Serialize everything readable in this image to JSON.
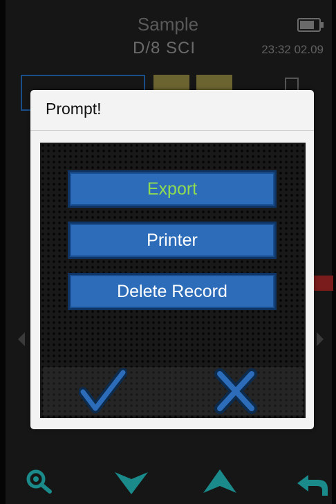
{
  "header": {
    "title": "Sample",
    "mode": "D/8   SCI",
    "datetime": "23:32 02.09"
  },
  "dialog": {
    "title": "Prompt!",
    "options": [
      {
        "label": "Export",
        "selected": true
      },
      {
        "label": "Printer",
        "selected": false
      },
      {
        "label": "Delete Record",
        "selected": false
      }
    ],
    "confirm_icon": "checkmark-icon",
    "cancel_icon": "cross-icon"
  },
  "nav": {
    "icons": [
      "search-icon",
      "down-arrow-icon",
      "up-arrow-icon",
      "back-icon"
    ]
  },
  "colors": {
    "accent_blue": "#2d6cb8",
    "selected_text": "#8fdc52",
    "nav_teal": "#1a8a8a"
  }
}
